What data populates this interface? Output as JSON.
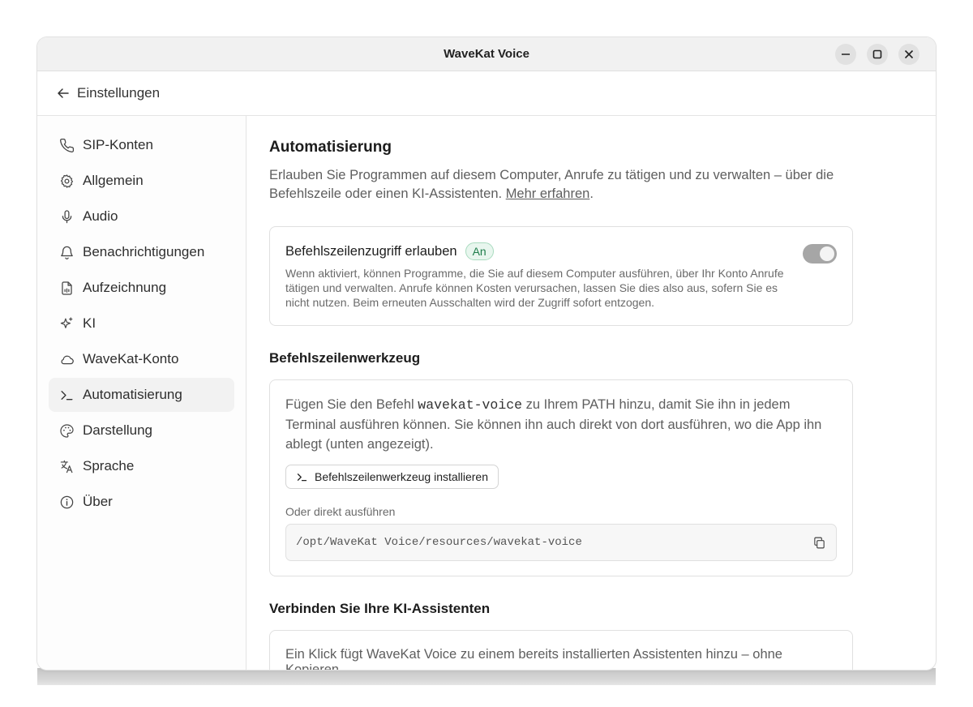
{
  "window": {
    "title": "WaveKat Voice"
  },
  "header": {
    "back_label": "Einstellungen"
  },
  "sidebar": {
    "items": [
      {
        "label": "SIP-Konten",
        "icon": "phone-icon"
      },
      {
        "label": "Allgemein",
        "icon": "gear-icon"
      },
      {
        "label": "Audio",
        "icon": "microphone-icon"
      },
      {
        "label": "Benachrichtigungen",
        "icon": "bell-icon"
      },
      {
        "label": "Aufzeichnung",
        "icon": "file-audio-icon"
      },
      {
        "label": "KI",
        "icon": "sparkles-icon"
      },
      {
        "label": "WaveKat-Konto",
        "icon": "cloud-icon"
      },
      {
        "label": "Automatisierung",
        "icon": "terminal-icon",
        "active": true
      },
      {
        "label": "Darstellung",
        "icon": "palette-icon"
      },
      {
        "label": "Sprache",
        "icon": "languages-icon"
      },
      {
        "label": "Über",
        "icon": "info-icon"
      }
    ]
  },
  "main": {
    "title": "Automatisierung",
    "intro_text": "Erlauben Sie Programmen auf diesem Computer, Anrufe zu tätigen und zu verwalten – über die Befehlszeile oder einen KI-Assistenten.",
    "intro_link": "Mehr erfahren",
    "intro_end": ".",
    "cli_access": {
      "label": "Befehlszeilenzugriff erlauben",
      "badge": "An",
      "description": "Wenn aktiviert, können Programme, die Sie auf diesem Computer ausführen, über Ihr Konto Anrufe tätigen und verwalten. Anrufe können Kosten verursachen, lassen Sie dies also aus, sofern Sie es nicht nutzen. Beim erneuten Ausschalten wird der Zugriff sofort entzogen.",
      "enabled": true
    },
    "cli_tool": {
      "heading": "Befehlszeilenwerkzeug",
      "text_before": "Fügen Sie den Befehl ",
      "command": "wavekat-voice",
      "text_after": " zu Ihrem PATH hinzu, damit Sie ihn in jedem Terminal ausführen können. Sie können ihn auch direkt von dort ausführen, wo die App ihn ablegt (unten angezeigt).",
      "install_button": "Befehlszeilenwerkzeug installieren",
      "direct_label": "Oder direkt ausführen",
      "path": "/opt/WaveKat Voice/resources/wavekat-voice"
    },
    "assistants": {
      "heading": "Verbinden Sie Ihre KI-Assistenten",
      "text": "Ein Klick fügt WaveKat Voice zu einem bereits installierten Assistenten hinzu – ohne Kopieren."
    }
  },
  "colors": {
    "toggle_on": "#a6a6a6",
    "badge_green": "#1e7d4a",
    "active_nav_bg": "#f2f2f2"
  }
}
